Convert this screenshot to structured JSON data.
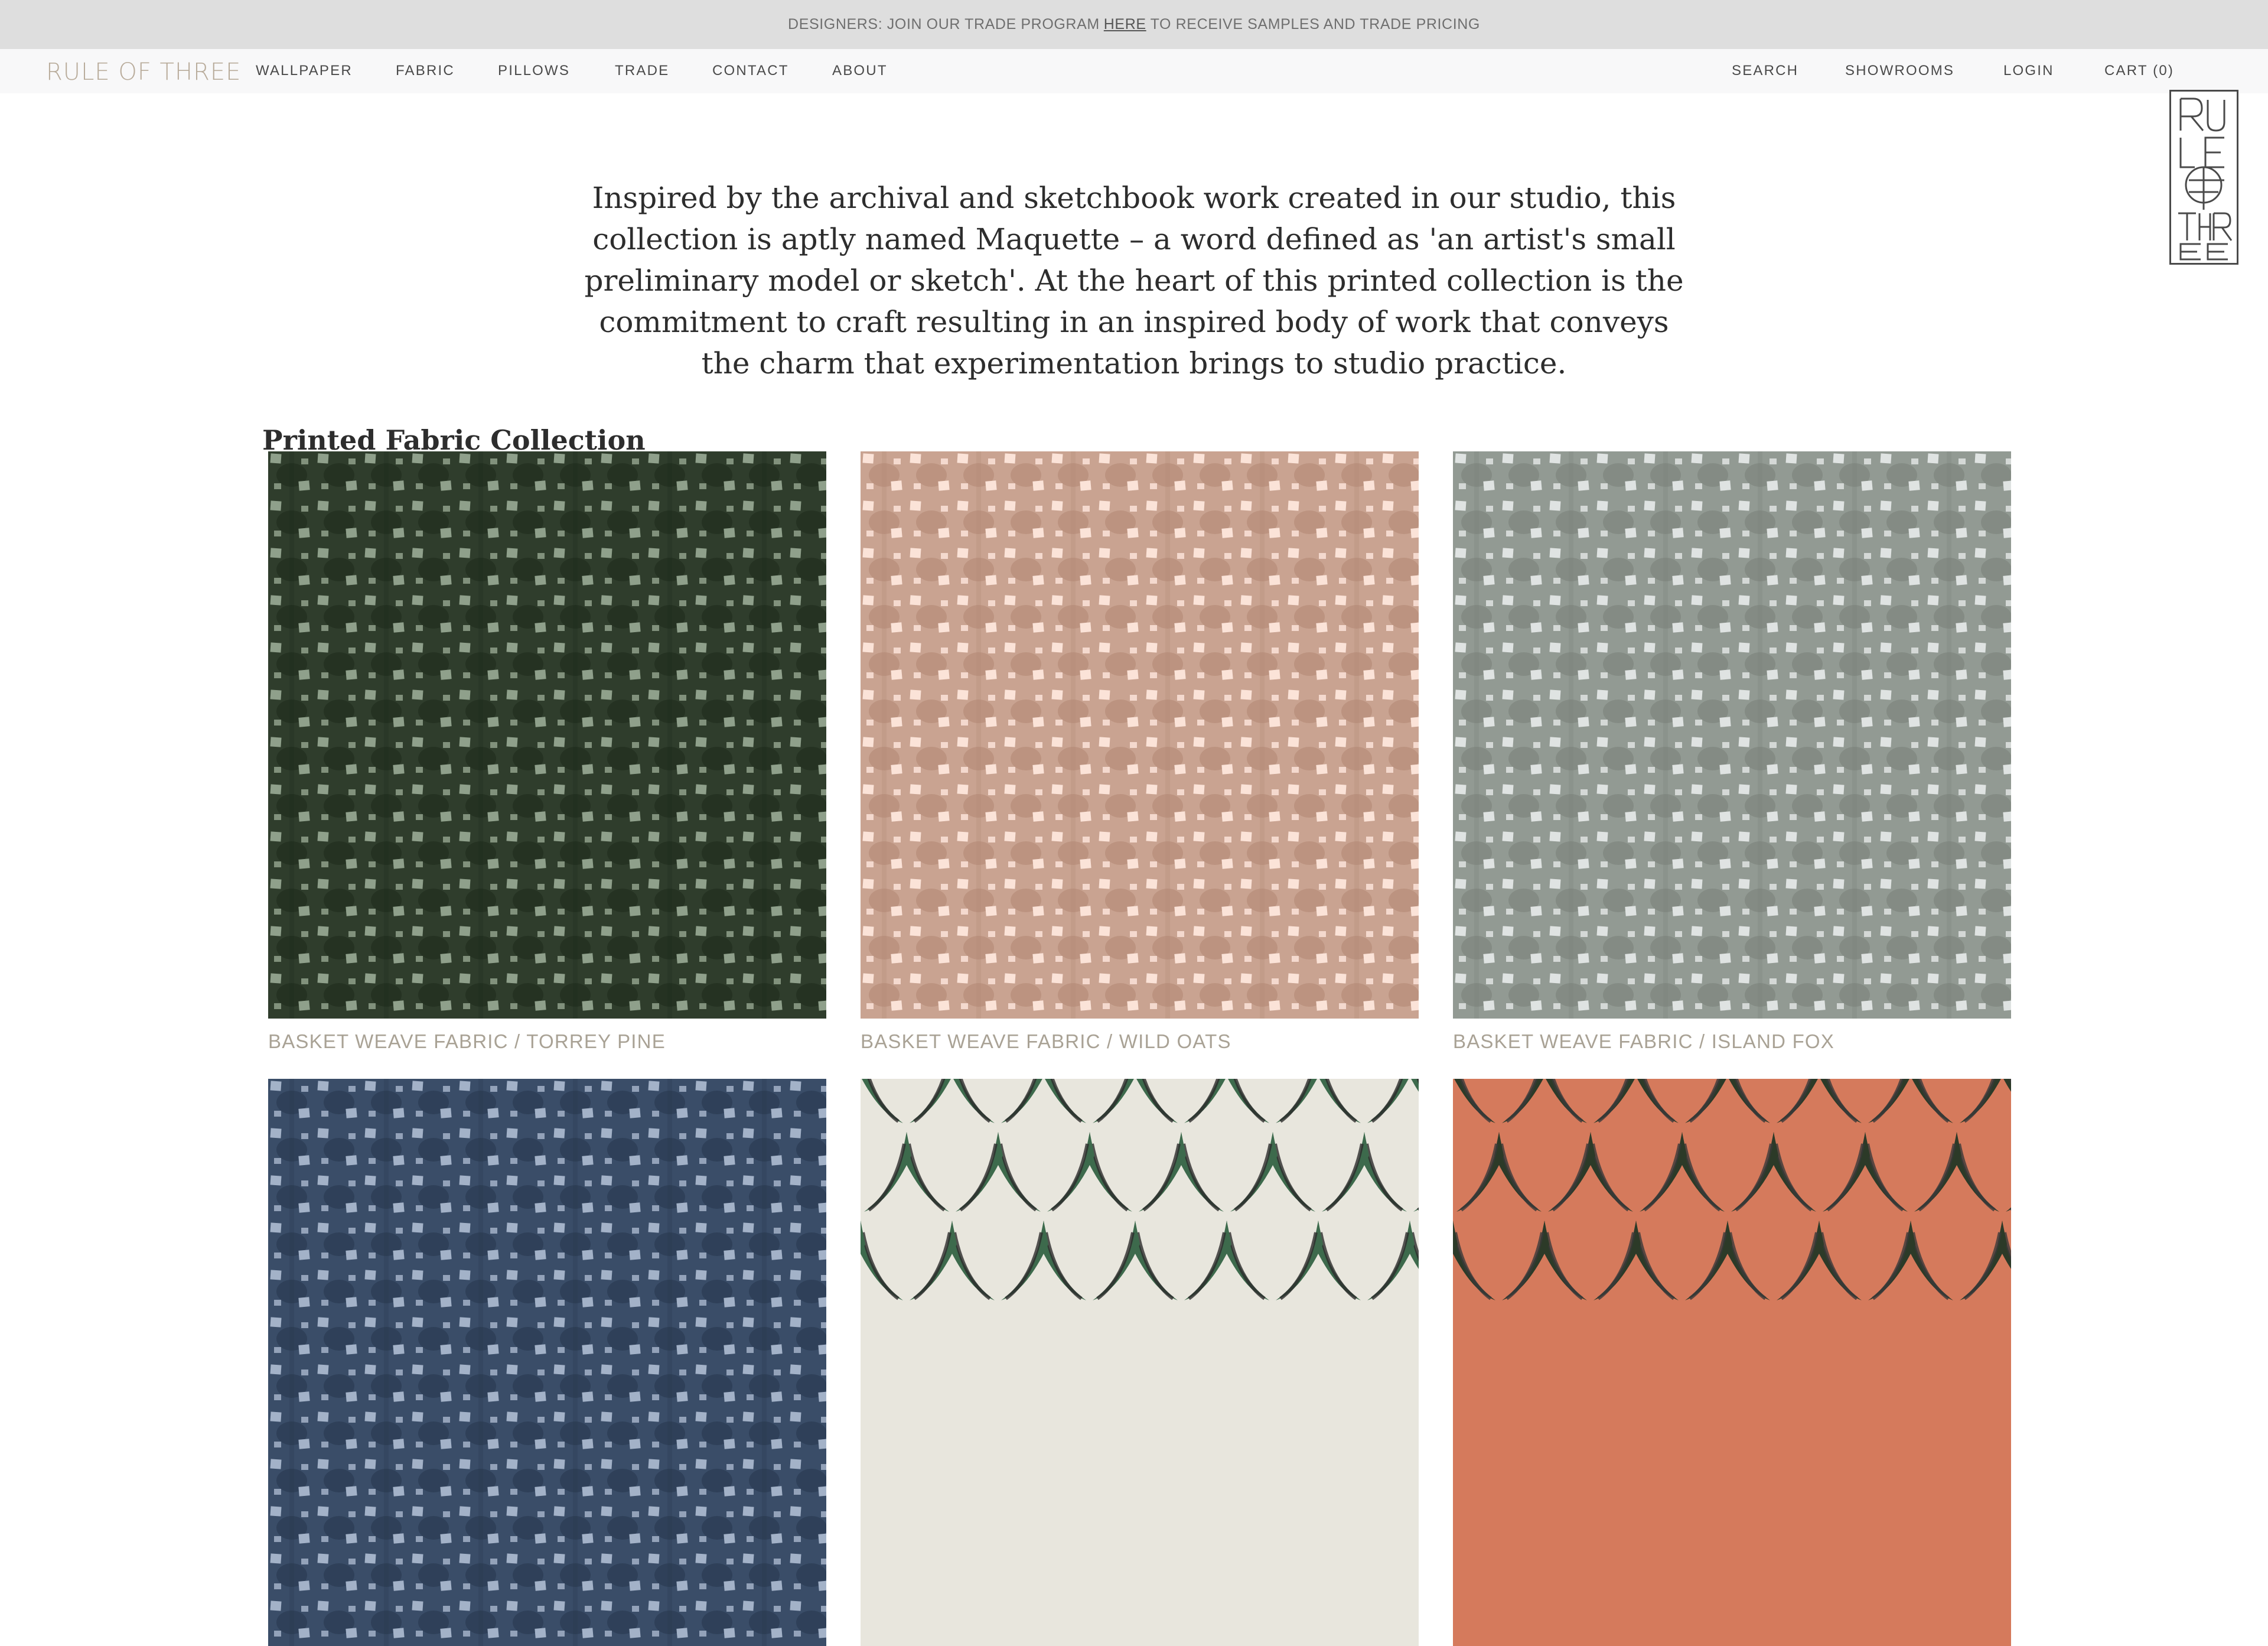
{
  "announcement": {
    "prefix": "DESIGNERS: JOIN OUR TRADE PROGRAM",
    "link": "HERE",
    "suffix": "TO RECEIVE SAMPLES AND TRADE PRICING"
  },
  "brand": {
    "name": "RULE OF THREE"
  },
  "nav": {
    "main": [
      "WALLPAPER",
      "FABRIC",
      "PILLOWS",
      "TRADE",
      "CONTACT",
      "ABOUT"
    ],
    "utility": [
      "SEARCH",
      "SHOWROOMS",
      "LOGIN",
      "CART (0)"
    ]
  },
  "intro": {
    "text": "Inspired by the archival and sketchbook work created in our studio, this collection is aptly named Maquette – a word defined as 'an artist's small preliminary model or sketch'. At the heart of this printed collection is the commitment to craft resulting in an inspired body of work that conveys the charm that experimentation brings to studio practice."
  },
  "collection": {
    "title": "Printed Fabric Collection",
    "products": [
      {
        "label": "BASKET WEAVE FABRIC / TORREY PINE",
        "pattern": "weave",
        "base": "#2f3d2c",
        "dark": "#1d2a1c",
        "light": "#8fa08b"
      },
      {
        "label": "BASKET WEAVE FABRIC / WILD OATS",
        "pattern": "weave",
        "base": "#c9a391",
        "dark": "#b08772",
        "light": "#fbe3d8"
      },
      {
        "label": "BASKET WEAVE FABRIC / ISLAND FOX",
        "pattern": "weave",
        "base": "#929a93",
        "dark": "#787f78",
        "light": "#dfe3e2"
      },
      {
        "label": "",
        "pattern": "weave",
        "base": "#3a4d68",
        "dark": "#26364d",
        "light": "#a3b2c8"
      },
      {
        "label": "",
        "pattern": "marble",
        "base": "#e8e6dd",
        "dark": "#3d6a4c",
        "light": "#2c2c2c"
      },
      {
        "label": "",
        "pattern": "marble",
        "base": "#d57a5c",
        "dark": "#2c3a28",
        "light": "#3a3a3a"
      }
    ]
  },
  "colors": {
    "announcement_bg": "#dedede",
    "nav_bg": "#f8f8f9",
    "brand_gold": "#b8ab9a",
    "body_text": "#2d2d2d"
  }
}
